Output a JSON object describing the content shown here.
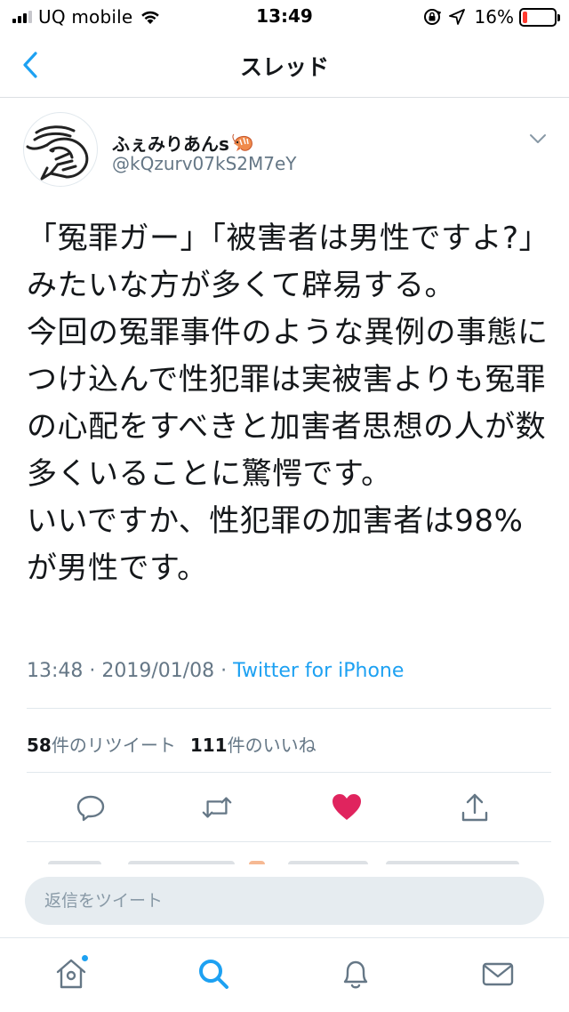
{
  "status_bar": {
    "carrier": "UQ mobile",
    "time": "13:49",
    "battery_percent": "16%",
    "battery_level": 0.16,
    "battery_color": "#ff3b30",
    "icons": [
      "signal-icon",
      "wifi-icon",
      "screen-rotation-lock-icon",
      "location-icon",
      "battery-icon"
    ]
  },
  "nav": {
    "title": "スレッド",
    "back_icon": "chevron-left-icon"
  },
  "tweet": {
    "display_name": "ふぇみりあんs",
    "name_emoji": "shrimp-emoji",
    "handle": "@kQzurv07kS2M7eY",
    "text": "「冤罪ガー」「被害者は男性ですよ?」みたいな方が多くて辟易する。\n今回の冤罪事件のような異例の事態につけ込んで性犯罪は実被害よりも冤罪の心配をすべきと加害者思想の人が数多くいることに驚愕です。\nいいですか、性犯罪の加害者は98%が男性です。",
    "timestamp": "13:48 · 2019/01/08 · ",
    "source": "Twitter for iPhone",
    "retweet_count": "58",
    "retweet_label": "件のリツイート",
    "like_count": "111",
    "like_label": "件のいいね",
    "liked": true
  },
  "actions": [
    "reply-icon",
    "retweet-icon",
    "like-icon",
    "share-icon"
  ],
  "compose": {
    "placeholder": "返信をツイート"
  },
  "tab_bar": [
    "home-icon",
    "search-icon",
    "notifications-icon",
    "messages-icon"
  ],
  "colors": {
    "accent": "#1da1f2",
    "like": "#e0245e",
    "secondary_text": "#657786"
  }
}
